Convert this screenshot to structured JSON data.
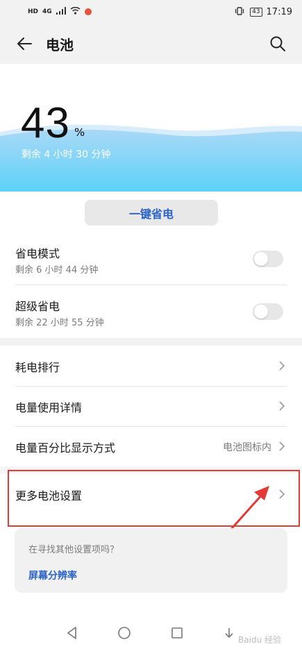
{
  "status_bar": {
    "left_indicators": [
      "HD",
      "4G"
    ],
    "time": "17:19",
    "battery_level": "43"
  },
  "header": {
    "title": "电池"
  },
  "battery": {
    "percent": "43",
    "percent_sign": "%",
    "remaining": "剩余 4 小时 30 分钟"
  },
  "one_key_save": "一键省电",
  "power_modes": [
    {
      "title": "省电模式",
      "subtitle": "剩余 6 小时 44 分钟",
      "enabled": false
    },
    {
      "title": "超级省电",
      "subtitle": "剩余 22 小时 55 分钟",
      "enabled": false
    }
  ],
  "menu": [
    {
      "title": "耗电排行"
    },
    {
      "title": "电量使用详情"
    },
    {
      "title": "电量百分比显示方式",
      "value": "电池图标内"
    },
    {
      "title": "更多电池设置"
    }
  ],
  "suggestion": {
    "question": "在寻找其他设置项吗？",
    "link": "屏幕分辨率"
  },
  "watermark": "Baidu 经验",
  "colors": {
    "accent": "#2a62c8",
    "wave_top": "#a8d6f5",
    "wave_bottom": "#5fd0f7",
    "highlight": "#e53935"
  }
}
